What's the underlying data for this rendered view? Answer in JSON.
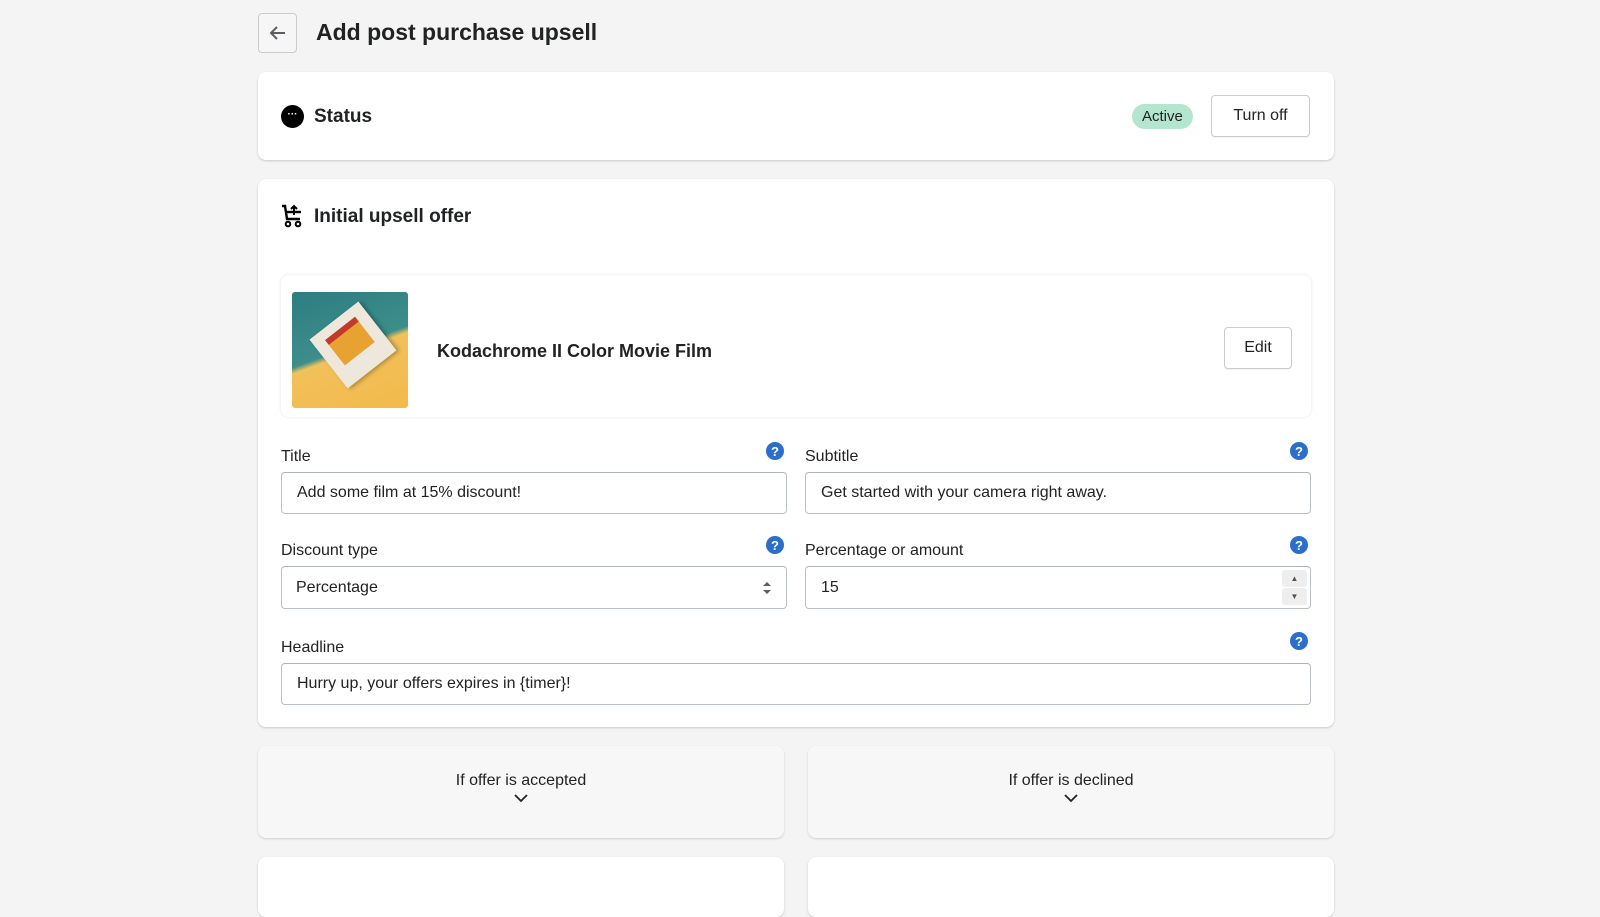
{
  "header": {
    "title": "Add post purchase upsell",
    "back_icon": "arrow-left-icon"
  },
  "status": {
    "title": "Status",
    "badge": "Active",
    "badge_color": "#b4e6cf",
    "turn_off_label": "Turn off"
  },
  "offer": {
    "title": "Initial upsell offer",
    "product": {
      "name": "Kodachrome II Color Movie Film",
      "edit_label": "Edit"
    },
    "fields": {
      "title": {
        "label": "Title",
        "value": "Add some film at 15% discount!"
      },
      "subtitle": {
        "label": "Subtitle",
        "value": "Get started with your camera right away."
      },
      "discount_type": {
        "label": "Discount type",
        "value": "Percentage"
      },
      "amount": {
        "label": "Percentage or amount",
        "value": "15"
      },
      "headline": {
        "label": "Headline",
        "value": "Hurry up, your offers expires in {timer}!"
      }
    },
    "help_glyph": "?"
  },
  "sections": {
    "accepted": "If offer is accepted",
    "declined": "If offer is declined"
  },
  "accent": "#2c6ecb"
}
